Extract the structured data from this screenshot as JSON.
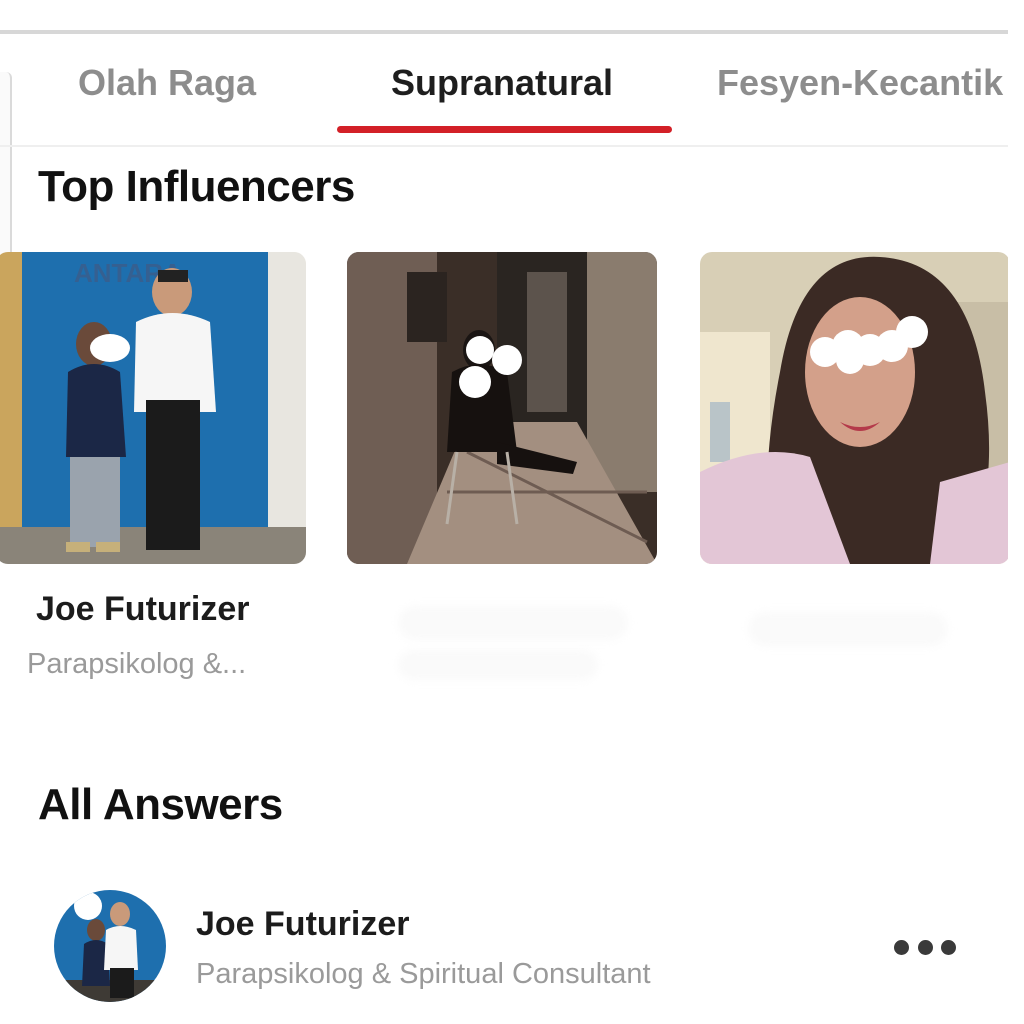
{
  "tabs": [
    {
      "label": "Olah Raga",
      "active": false
    },
    {
      "label": "Supranatural",
      "active": true
    },
    {
      "label": "Fesyen-Kecantik",
      "active": false
    }
  ],
  "colors": {
    "accent": "#d32027",
    "text": "#1e1e1e",
    "muted": "#8d8d8d"
  },
  "top_influencers": {
    "title": "Top Influencers",
    "cards": [
      {
        "name": "Joe Futurizer",
        "subtitle": "Parapsikolog &...",
        "photo_icon": "photo-two-people-icon"
      },
      {
        "name": "",
        "subtitle": "",
        "photo_icon": "photo-seated-person-hallway-icon"
      },
      {
        "name": "",
        "subtitle": "",
        "photo_icon": "photo-woman-portrait-icon"
      }
    ]
  },
  "all_answers": {
    "title": "All Answers",
    "first_answer": {
      "author": "Joe Futurizer",
      "author_title": "Parapsikolog & Spiritual Consultant",
      "menu_icon": "more-options-icon"
    }
  }
}
